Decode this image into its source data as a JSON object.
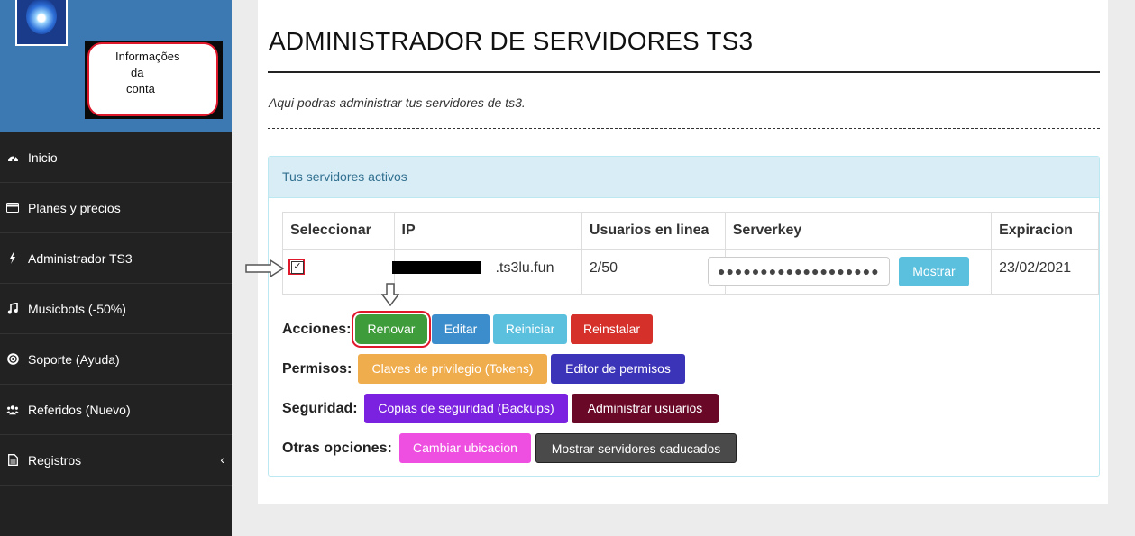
{
  "sidebar": {
    "info_box": {
      "line1": "Informações",
      "line2": "da",
      "line3": "conta"
    },
    "items": [
      {
        "label": "Inicio",
        "icon": "dashboard-icon"
      },
      {
        "label": "Planes y precios",
        "icon": "credit-card-icon"
      },
      {
        "label": "Administrador TS3",
        "icon": "bolt-icon"
      },
      {
        "label": "Musicbots (-50%)",
        "icon": "music-icon"
      },
      {
        "label": "Soporte (Ayuda)",
        "icon": "lifebuoy-icon"
      },
      {
        "label": "Referidos (Nuevo)",
        "icon": "users-icon"
      },
      {
        "label": "Registros",
        "icon": "file-icon"
      }
    ]
  },
  "main": {
    "title": "ADMINISTRADOR DE SERVIDORES TS3",
    "subtitle": "Aqui podras administrar tus servidores de ts3.",
    "panel_title": "Tus servidores activos",
    "table": {
      "headers": [
        "Seleccionar",
        "IP",
        "Usuarios en linea",
        "Serverkey",
        "Expiracion"
      ],
      "row": {
        "selected": true,
        "ip_visible": ".ts3lu.fun",
        "users": "2/50",
        "serverkey_masked": "●●●●●●●●●●●●●●●●●●●",
        "show_button": "Mostrar",
        "expiration": "23/02/2021"
      }
    },
    "actions": {
      "label": "Acciones:",
      "buttons": [
        "Renovar",
        "Editar",
        "Reiniciar",
        "Reinstalar"
      ]
    },
    "permisos": {
      "label": "Permisos:",
      "buttons": [
        "Claves de privilegio (Tokens)",
        "Editor de permisos"
      ]
    },
    "seguridad": {
      "label": "Seguridad:",
      "buttons": [
        "Copias de seguridad (Backups)",
        "Administrar usuarios"
      ]
    },
    "otras": {
      "label": "Otras opciones:",
      "buttons": [
        "Cambiar ubicacion",
        "Mostrar servidores caducados"
      ]
    }
  },
  "colors": {
    "sidebar_bg": "#222222",
    "sidebar_header": "#3c79b2",
    "panel_head": "#d9edf7",
    "renovar": "#3e9c3a",
    "editar": "#3c8dcc",
    "reiniciar": "#5bc0de",
    "reinstalar": "#d5302a",
    "tokens": "#f0ad4e",
    "editor_permisos": "#3b33b8",
    "backups": "#7b22e0",
    "admin_usuarios": "#6a0828",
    "cambiar_ubicacion": "#ef4fe1",
    "caducados": "#4a4a4a",
    "highlight": "#e0182c"
  }
}
